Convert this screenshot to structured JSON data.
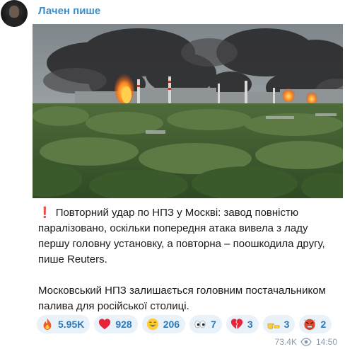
{
  "message": {
    "sender_name": "Лачен пише",
    "paragraph_1": "Повторний удар по НПЗ у Москві: завод повністю паралізовано, оскільки попередня атака вивела з ладу першу головну установку, а повторна – поошкодила другу, пише Reuters.",
    "paragraph_2": "Московський НПЗ залишається головним постачальником палива для російської столиці.",
    "views": "73.4K",
    "time": "14:50"
  },
  "reactions": [
    {
      "icon": "fire-emoji-icon",
      "count": "5.95K"
    },
    {
      "icon": "heart-emoji-icon",
      "count": "928"
    },
    {
      "icon": "grinning-emoji-icon",
      "count": "206"
    },
    {
      "icon": "eyes-emoji-icon",
      "count": "7"
    },
    {
      "icon": "broken-heart-emoji-icon",
      "count": "3"
    },
    {
      "icon": "pointing-hand-emoji-icon",
      "count": "3"
    },
    {
      "icon": "angry-emoji-icon",
      "count": "2"
    }
  ],
  "colors": {
    "sender": "#3a8ec9",
    "reaction_bg": "#e9f1f9",
    "reaction_text": "#2f78b7",
    "meta": "#8a9aa8"
  }
}
